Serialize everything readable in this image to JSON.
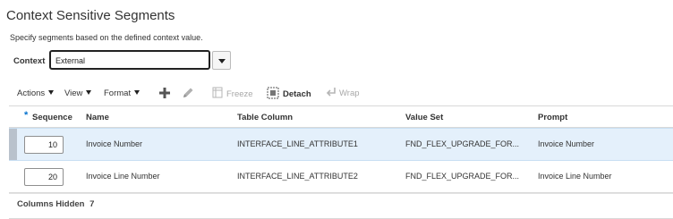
{
  "page": {
    "title": "Context Sensitive Segments",
    "description": "Specify segments based on the defined context value."
  },
  "context": {
    "label": "Context",
    "value": "External"
  },
  "toolbar": {
    "actions": "Actions",
    "view": "View",
    "format": "Format",
    "freeze": "Freeze",
    "detach": "Detach",
    "wrap": "Wrap"
  },
  "table": {
    "required_marker": "*",
    "headers": {
      "sequence": "Sequence",
      "name": "Name",
      "table_column": "Table Column",
      "value_set": "Value Set",
      "prompt": "Prompt"
    },
    "rows": [
      {
        "sequence": "10",
        "name": "Invoice Number",
        "table_column": "INTERFACE_LINE_ATTRIBUTE1",
        "value_set": "FND_FLEX_UPGRADE_FOR...",
        "prompt": "Invoice Number",
        "selected": true
      },
      {
        "sequence": "20",
        "name": "Invoice Line Number",
        "table_column": "INTERFACE_LINE_ATTRIBUTE2",
        "value_set": "FND_FLEX_UPGRADE_FOR...",
        "prompt": "Invoice Line Number",
        "selected": false
      }
    ]
  },
  "footer": {
    "columns_hidden_label": "Columns Hidden",
    "columns_hidden_count": "7"
  },
  "icons": {
    "add": "plus-icon",
    "edit": "pencil-icon",
    "freeze": "freeze-icon",
    "detach": "detach-icon",
    "wrap": "wrap-icon"
  },
  "colors": {
    "selected_row": "#e4f0fb",
    "required_marker": "#0572ce",
    "disabled_text": "#a8a8a8"
  }
}
